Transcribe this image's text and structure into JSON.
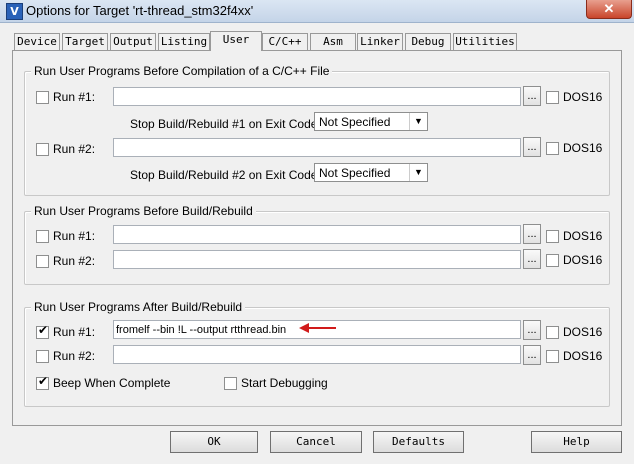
{
  "window": {
    "title": "Options for Target 'rt-thread_stm32f4xx'",
    "close": "✕",
    "app_icon_glyph": "V"
  },
  "tabs": [
    "Device",
    "Target",
    "Output",
    "Listing",
    "User",
    "C/C++",
    "Asm",
    "Linker",
    "Debug",
    "Utilities"
  ],
  "active_tab": "User",
  "groups": {
    "compile": {
      "title": "Run User Programs Before Compilation of a C/C++ File",
      "run1": {
        "label": "Run #1:",
        "checked": false,
        "value": "",
        "dos16": "DOS16"
      },
      "stop1_label": "Stop Build/Rebuild #1 on Exit Code:",
      "stop1_value": "Not Specified",
      "run2": {
        "label": "Run #2:",
        "checked": false,
        "value": "",
        "dos16": "DOS16"
      },
      "stop2_label": "Stop Build/Rebuild #2 on Exit Code:",
      "stop2_value": "Not Specified"
    },
    "before_build": {
      "title": "Run User Programs Before Build/Rebuild",
      "run1": {
        "label": "Run #1:",
        "checked": false,
        "value": "",
        "dos16": "DOS16"
      },
      "run2": {
        "label": "Run #2:",
        "checked": false,
        "value": "",
        "dos16": "DOS16"
      }
    },
    "after_build": {
      "title": "Run User Programs After Build/Rebuild",
      "run1": {
        "label": "Run #1:",
        "checked": true,
        "value": "fromelf --bin !L --output rtthread.bin",
        "dos16": "DOS16"
      },
      "run2": {
        "label": "Run #2:",
        "checked": false,
        "value": "",
        "dos16": "DOS16"
      },
      "beep": {
        "label": "Beep When Complete",
        "checked": true
      },
      "debug": {
        "label": "Start Debugging",
        "checked": false
      }
    }
  },
  "browse_label": "...",
  "check_glyph": "✔",
  "dropdown_arrow": "▼",
  "buttons": {
    "ok": "OK",
    "cancel": "Cancel",
    "defaults": "Defaults",
    "help": "Help"
  },
  "annotation_color": "#d11b1b"
}
